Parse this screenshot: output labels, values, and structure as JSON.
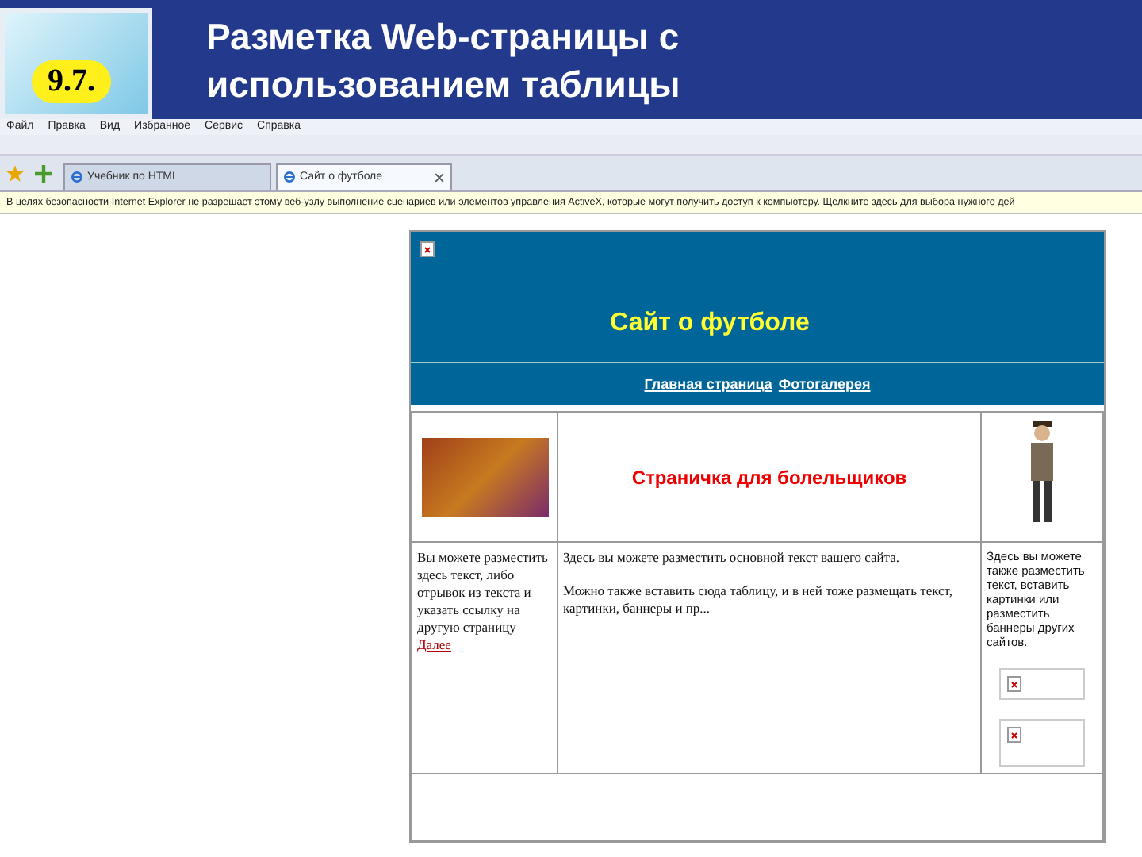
{
  "slide": {
    "number": "9.7.",
    "title": "Разметка Web-страницы с использованием таблицы"
  },
  "browser": {
    "menu": [
      "Файл",
      "Правка",
      "Вид",
      "Избранное",
      "Сервис",
      "Справка"
    ],
    "tabs": [
      {
        "label": "Учебник по HTML",
        "selected": false
      },
      {
        "label": "Сайт о футболе",
        "selected": true
      }
    ],
    "info_bar": "В целях безопасности Internet Explorer не разрешает этому веб-узлу выполнение сценариев или элементов управления ActiveX, которые могут получить доступ к компьютеру. Щелкните здесь для выбора нужного дей"
  },
  "page": {
    "site_title": "Сайт о футболе",
    "nav_links": [
      "Главная страница",
      "Фотогалерея"
    ],
    "banner_heading": "Страничка для болельщиков",
    "left_text": "Вы можете разместить здесь текст, либо отрывок из текста и указать ссылку на другую страницу",
    "left_link": "Далее",
    "main_paragraphs": [
      "Здесь вы можете разместить основной текст вашего сайта.",
      "Можно также вставить сюда таблицу, и в ней тоже размещать текст, картинки, баннеры и пр..."
    ],
    "right_text": "Здесь вы можете также разместить текст, вставить картинки или разместить баннеры других сайтов."
  }
}
